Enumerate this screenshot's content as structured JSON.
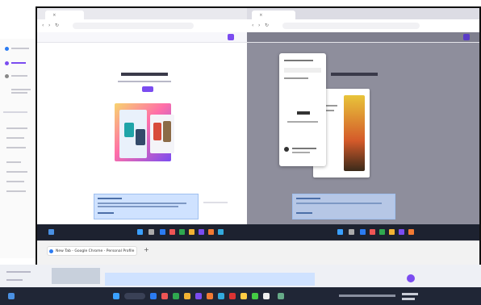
{
  "browser": {
    "tab_title": "New Tab - Google Chrome - Personal Profile",
    "tab_close": "×",
    "new_tab": "+"
  },
  "icons": {
    "back": "‹",
    "forward": "›",
    "reload": "↻"
  },
  "colors": {
    "accent": "#7b4cf0",
    "taskbar": "#1d2230",
    "notice": "#cfe2ff",
    "overlay": "#8e8e9c"
  }
}
